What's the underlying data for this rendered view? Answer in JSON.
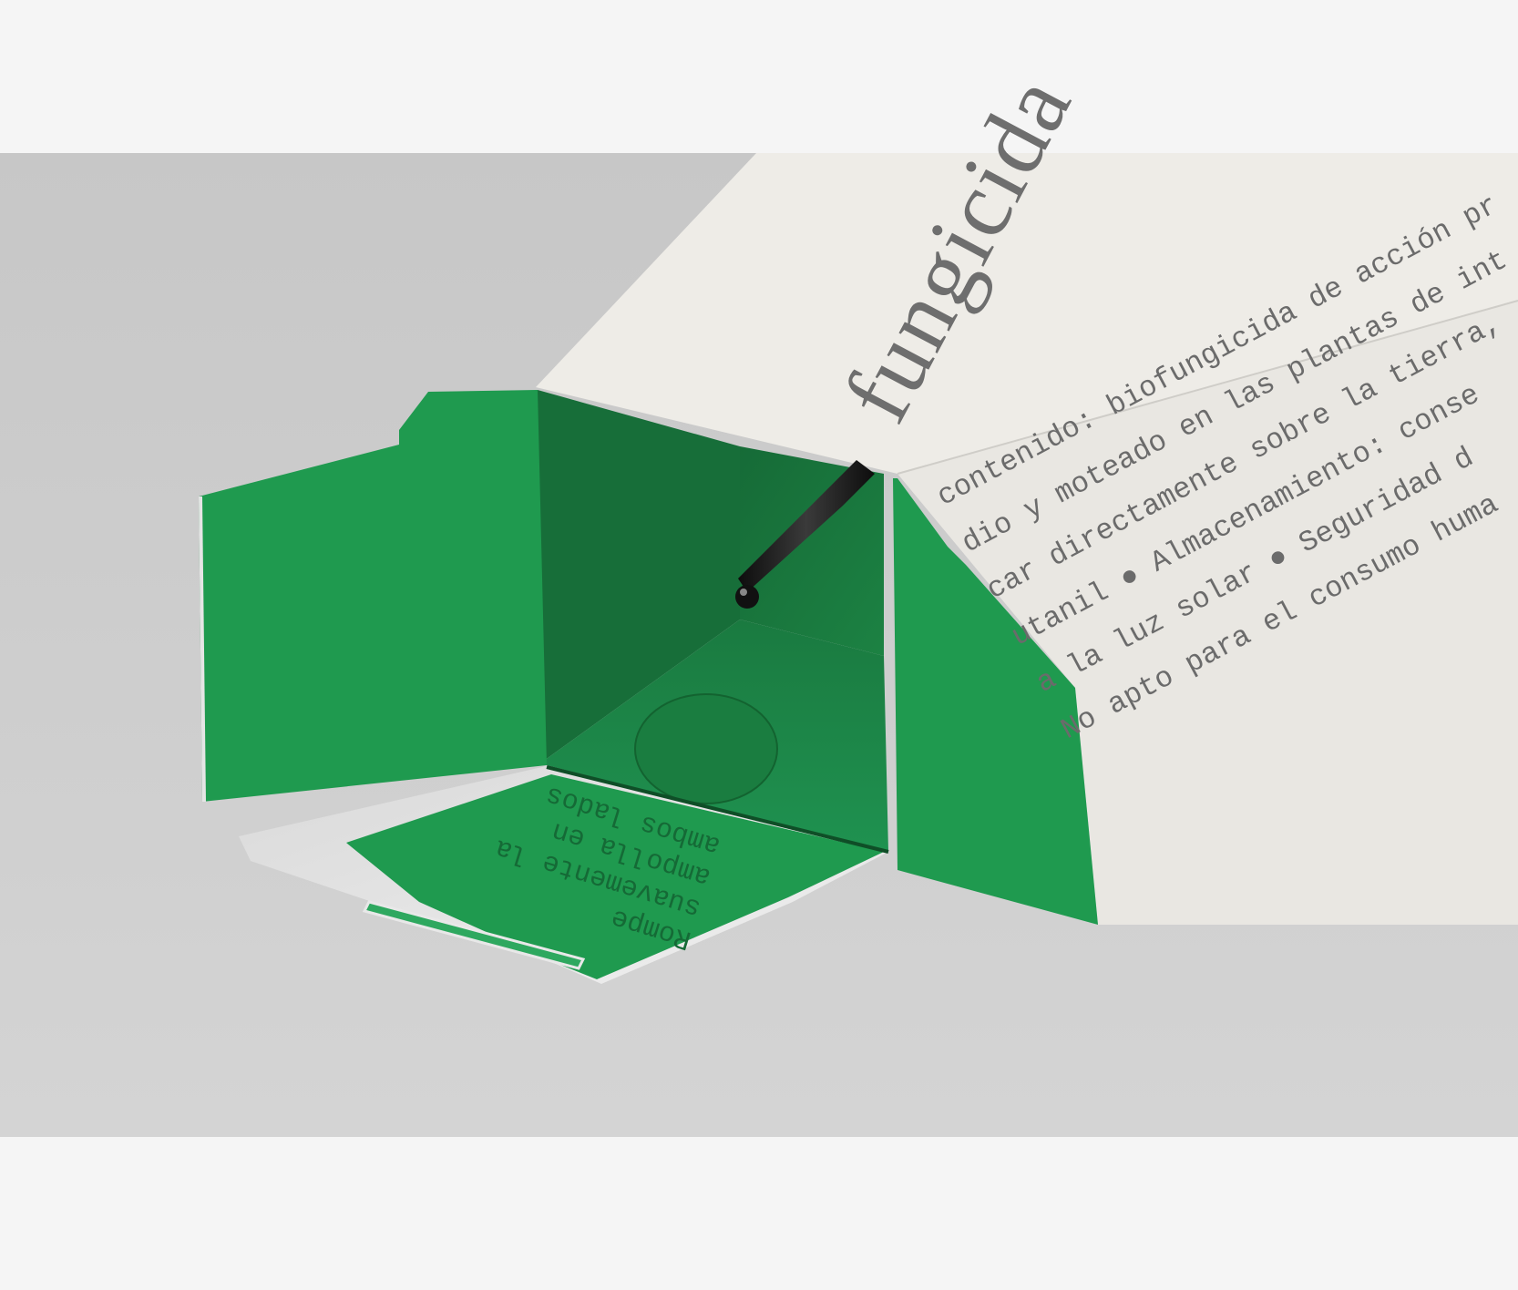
{
  "colors": {
    "page_background": "#f5f5f5",
    "backdrop": "#cbcbcb",
    "box_white": "#eeece7",
    "box_green": "#1f9a4f",
    "box_green_dark": "#1a7d41",
    "print_grey": "#6e6e6e",
    "tray_white": "#e3e3e3"
  },
  "icon_names": [
    "ampoule-icon",
    "bullet-dot-icon"
  ],
  "box": {
    "brand_word": "fungicida",
    "side_lines": [
      "contenido: biofungicida de acción pr",
      "dio y moteado en las plantas de int",
      "car directamente sobre la tierra,",
      "utanil ● Almacenamiento: conse",
      "a la luz solar ● Seguridad d",
      "No apto para el consumo huma"
    ]
  },
  "flap": {
    "instructions": [
      "Rompe",
      "suavemente la",
      "ampolla en",
      "ambos lados"
    ]
  }
}
